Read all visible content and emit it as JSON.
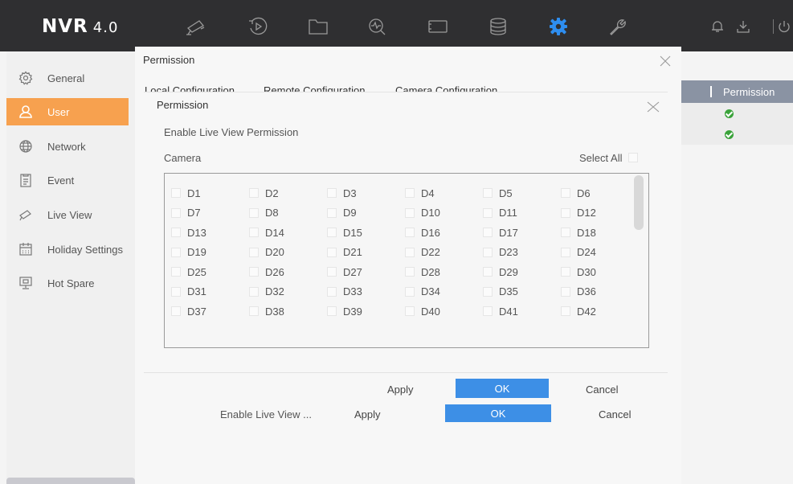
{
  "app": {
    "logo_main": "NVR",
    "logo_version": "4.0"
  },
  "topbar": {
    "nav_icons": [
      "live-view-camera-icon",
      "playback-icon",
      "file-management-icon",
      "smart-analysis-icon",
      "system-maintenance-icon",
      "storage-icon",
      "configuration-gear-icon",
      "tools-wrench-icon"
    ],
    "active_icon": "configuration-gear-icon",
    "right_icons": [
      "bell-icon",
      "download-icon",
      "power-icon"
    ]
  },
  "sidebar": {
    "items": [
      {
        "label": "General",
        "icon": "gear-icon"
      },
      {
        "label": "User",
        "icon": "user-icon",
        "active": true
      },
      {
        "label": "Network",
        "icon": "globe-icon"
      },
      {
        "label": "Event",
        "icon": "clipboard-icon"
      },
      {
        "label": "Live View",
        "icon": "camera-icon"
      },
      {
        "label": "Holiday Settings",
        "icon": "calendar-icon"
      },
      {
        "label": "Hot Spare",
        "icon": "monitor-icon"
      }
    ]
  },
  "right_panel": {
    "header": "Permission",
    "rows": [
      "check",
      "check"
    ]
  },
  "outer_dialog": {
    "title": "Permission",
    "tabs": [
      "Local Configuration",
      "Remote Configuration",
      "Camera Configuration"
    ],
    "bottom_label": "Enable Live View ...",
    "apply": "Apply",
    "ok": "OK",
    "cancel": "Cancel"
  },
  "inner_dialog": {
    "title": "Permission",
    "enable_label": "Enable Live View Permission",
    "camera_label": "Camera",
    "select_all": "Select All",
    "cameras": [
      "D1",
      "D2",
      "D3",
      "D4",
      "D5",
      "D6",
      "D7",
      "D8",
      "D9",
      "D10",
      "D11",
      "D12",
      "D13",
      "D14",
      "D15",
      "D16",
      "D17",
      "D18",
      "D19",
      "D20",
      "D21",
      "D22",
      "D23",
      "D24",
      "D25",
      "D26",
      "D27",
      "D28",
      "D29",
      "D30",
      "D31",
      "D32",
      "D33",
      "D34",
      "D35",
      "D36",
      "D37",
      "D38",
      "D39",
      "D40",
      "D41",
      "D42"
    ],
    "apply": "Apply",
    "ok": "OK",
    "cancel": "Cancel"
  },
  "colors": {
    "topbar": "#2f2f31",
    "accent_orange": "#f7a14f",
    "ok_blue": "#3d8fe6",
    "header_grey": "#8a93a3",
    "check_green": "#3aa33a"
  }
}
